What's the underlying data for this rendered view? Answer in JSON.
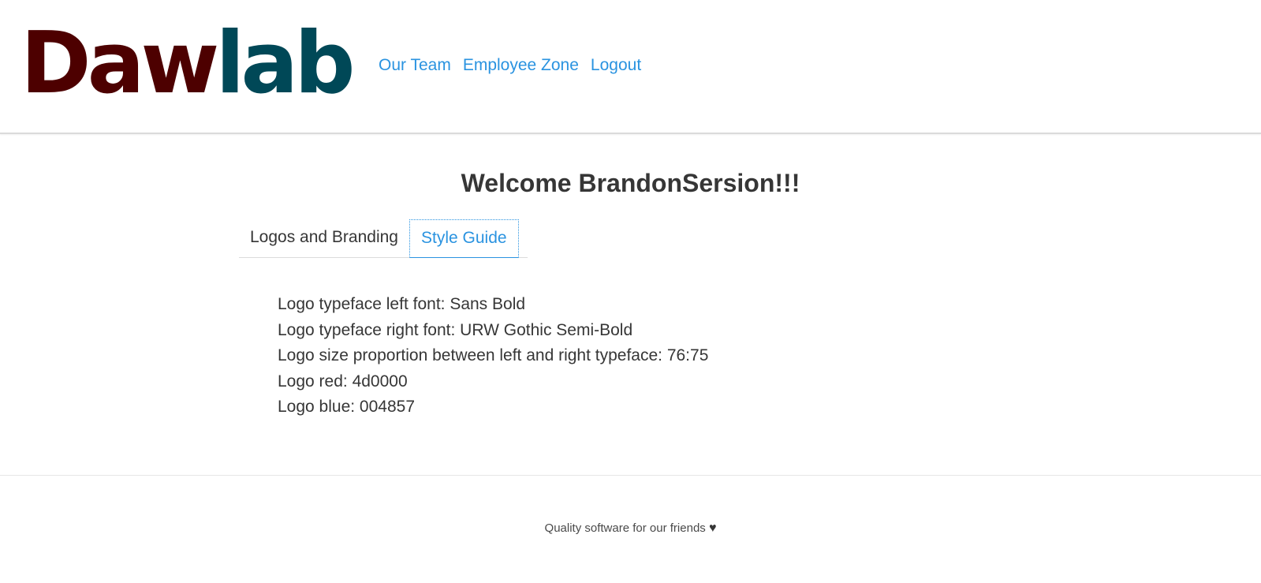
{
  "header": {
    "logo": {
      "left": "Daw",
      "right": "lab"
    },
    "nav": [
      {
        "label": "Our Team"
      },
      {
        "label": "Employee Zone"
      },
      {
        "label": "Logout"
      }
    ]
  },
  "main": {
    "title": "Welcome BrandonSersion!!!",
    "tabs": [
      {
        "label": "Logos and Branding",
        "active": false
      },
      {
        "label": "Style Guide",
        "active": true
      }
    ],
    "style_guide": [
      "Logo typeface left font: Sans Bold",
      "Logo typeface right font: URW Gothic Semi-Bold",
      "Logo size proportion between left and right typeface: 76:75",
      "Logo red: 4d0000",
      "Logo blue: 004857"
    ]
  },
  "footer": {
    "text": "Quality software for our friends",
    "icon": "heart-icon"
  },
  "colors": {
    "logo_red": "#4d0000",
    "logo_blue": "#004857",
    "link": "#2a93e0",
    "text": "#363636"
  }
}
